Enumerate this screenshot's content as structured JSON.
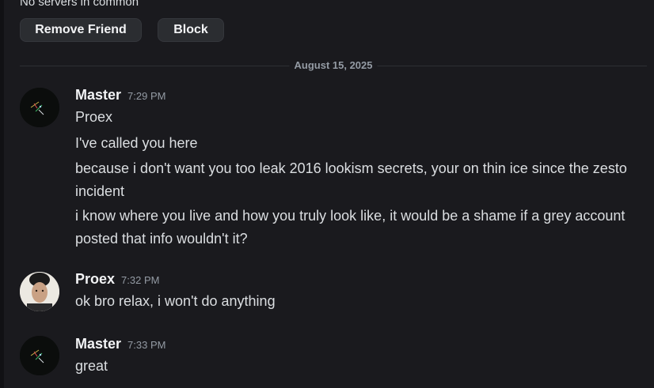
{
  "profile": {
    "mutual_servers_text": "No servers in common",
    "remove_friend_label": "Remove Friend",
    "block_label": "Block"
  },
  "divider": {
    "date": "August 15, 2025"
  },
  "messages": [
    {
      "author": "Master",
      "time": "7:29 PM",
      "lines": [
        "Proex",
        "I've called you here",
        "because i don't want you too leak 2016 lookism secrets, your on thin ice since the zesto incident",
        "i know where you live and how you truly look like, it would be a shame if a grey account posted that info wouldn't it?"
      ]
    },
    {
      "author": "Proex",
      "time": "7:32 PM",
      "lines": [
        "ok bro relax, i won't do anything"
      ]
    },
    {
      "author": "Master",
      "time": "7:33 PM",
      "lines": [
        "great"
      ]
    }
  ],
  "colors": {
    "background": "#1a1a1e",
    "button_bg": "#2b2d31",
    "text": "#dbdee1",
    "muted": "#949ba4"
  },
  "icons": {
    "master_avatar": "master-avatar-icon",
    "proex_avatar": "proex-avatar-photo"
  }
}
